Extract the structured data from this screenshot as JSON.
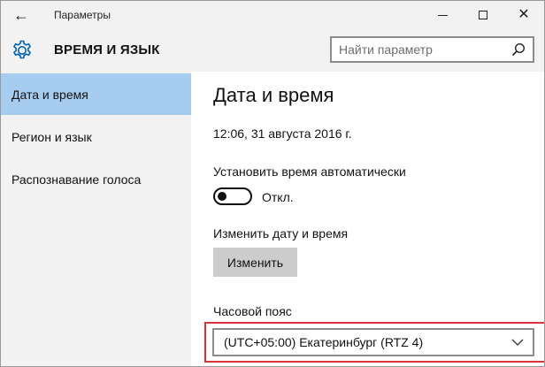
{
  "window": {
    "title": "Параметры",
    "back_glyph": "←",
    "close_glyph": "✕"
  },
  "header": {
    "title": "ВРЕМЯ И ЯЗЫК",
    "icon": "gear-icon"
  },
  "search": {
    "placeholder": "Найти параметр",
    "value": ""
  },
  "sidebar": {
    "items": [
      {
        "label": "Дата и время",
        "active": true
      },
      {
        "label": "Регион и язык",
        "active": false
      },
      {
        "label": "Распознавание голоса",
        "active": false
      }
    ]
  },
  "main": {
    "title": "Дата и время",
    "current_datetime": "12:06, 31 августа 2016 г.",
    "auto_time_label": "Установить время автоматически",
    "auto_time_state": "Откл.",
    "change_label": "Изменить дату и время",
    "change_button": "Изменить",
    "timezone_label": "Часовой пояс",
    "timezone_value": "(UTC+05:00) Екатеринбург (RTZ 4)"
  },
  "colors": {
    "active_nav": "#a6cdf0",
    "highlight": "#d9343a",
    "accent": "#0063b1"
  }
}
